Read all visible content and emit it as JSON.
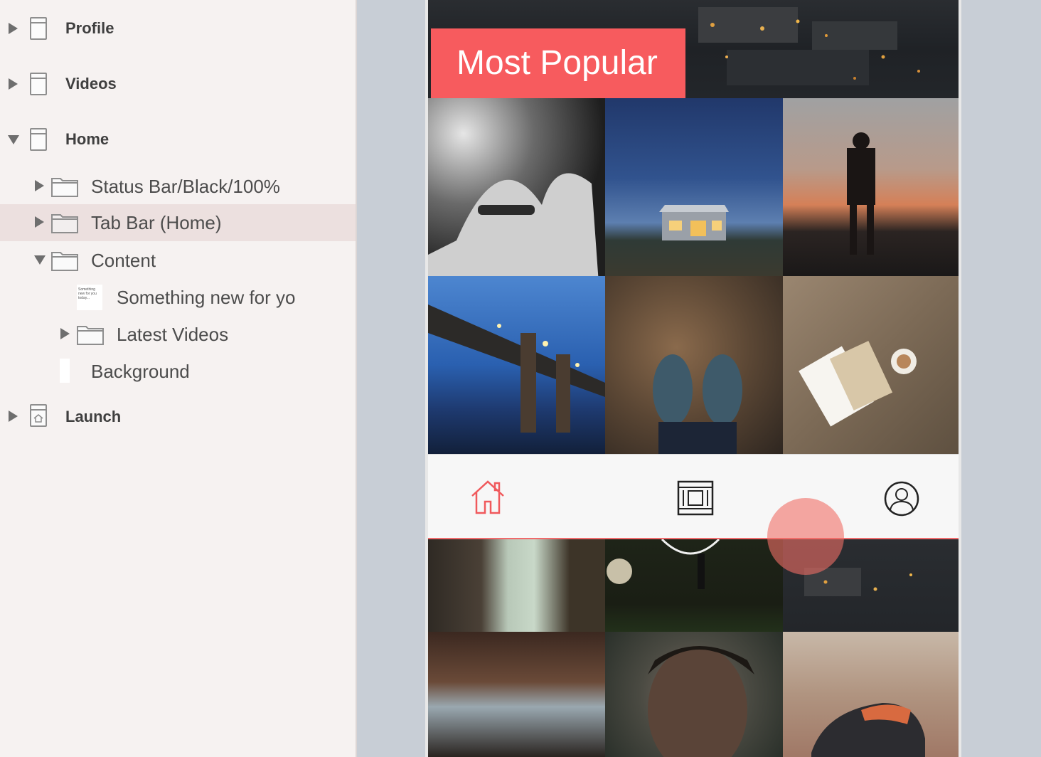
{
  "sidebar": {
    "profile": "Profile",
    "videos": "Videos",
    "home": "Home",
    "status_bar": "Status Bar/Black/100%",
    "tab_bar": "Tab Bar (Home)",
    "content": "Content",
    "something_new": "Something new for yo",
    "thumb_text": "Something new for you today...",
    "latest_videos": "Latest Videos",
    "background": "Background",
    "launch": "Launch"
  },
  "artboard": {
    "banner": "Most Popular"
  },
  "tabbar": {
    "items": [
      "home-icon",
      "film-icon",
      "profile-icon"
    ],
    "active_color": "#f0595c"
  },
  "colors": {
    "accent": "#f75b5e",
    "selection": "#ece0df"
  }
}
